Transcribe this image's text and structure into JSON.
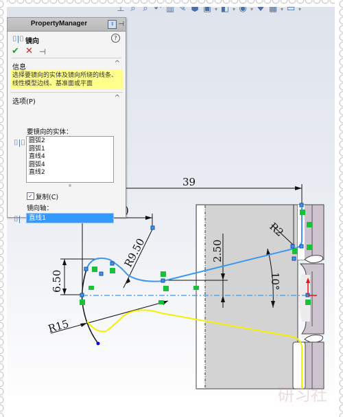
{
  "toolbar": {
    "icons": [
      "view-normal-icon",
      "zoom-to-fit-icon",
      "zoom-area-icon",
      "previous-view-icon",
      "section-view-icon",
      "dynamic-annotation-icon",
      "view-orientation-icon",
      "display-style-icon",
      "hide-show-items-icon",
      "edit-appearance-icon",
      "apply-scene-icon",
      "view-settings-icon",
      "monitor-icon"
    ]
  },
  "property_manager": {
    "title": "PropertyManager",
    "feature_name": "镜向",
    "help_glyph": "?",
    "ok_glyph": "✔",
    "cancel_glyph": "✕",
    "pin_glyph": "⊣",
    "info_section": {
      "label": "信息",
      "text": "选择要镜向的实体及镜向所绕的线条、线性模型边线、基准面或平面"
    },
    "options_section": {
      "label": "选项(P)",
      "entities_label": "要镜向的实体：",
      "entities": [
        "圆弧2",
        "圆弧1",
        "直线4",
        "圆弧4",
        "直线2"
      ],
      "copy_checkbox": {
        "label": "复制(C)",
        "checked": true
      },
      "axis_label": "镜向轴：",
      "axis_value": "直线1"
    },
    "collapse_glyph": "^"
  },
  "drawing": {
    "dimensions": {
      "horizontal_39": "39",
      "radius_r9_50": "R9.50",
      "vertical_6_50": "6.50",
      "vertical_2_50": "2.50",
      "radius_r2": "R2",
      "angle_10": "10°",
      "radius_r15": "R15",
      "partial_top": ")"
    },
    "colors": {
      "selected_curve": "#3d96f0",
      "mirrored_preview": "#f4f000",
      "centerline": "#3d96f0",
      "relation_badge": "#19c03a",
      "part_face": "#d3d3d3"
    }
  },
  "watermark": "研习社"
}
